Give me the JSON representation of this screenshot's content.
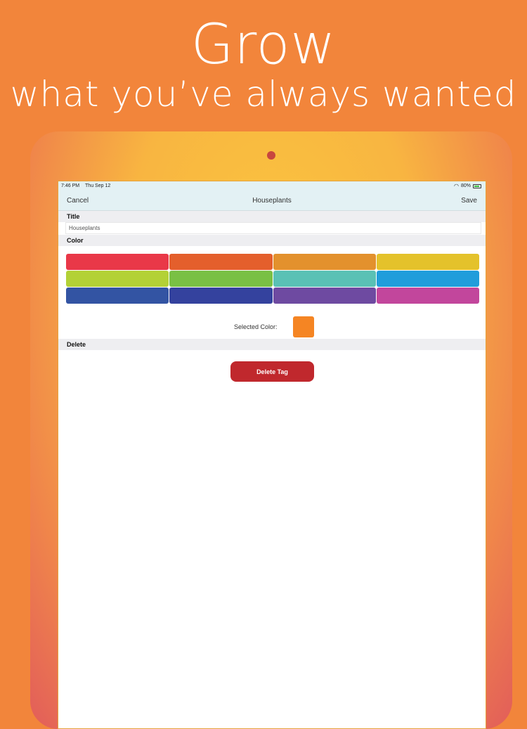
{
  "promo": {
    "headline": "Grow",
    "subheadline": "what you’ve always wanted"
  },
  "status_bar": {
    "time": "7:46 PM",
    "date": "Thu Sep 12",
    "battery": "80%"
  },
  "nav": {
    "cancel_label": "Cancel",
    "title": "Houseplants",
    "save_label": "Save"
  },
  "sections": {
    "title_header": "Title",
    "color_header": "Color",
    "delete_header": "Delete"
  },
  "form": {
    "title_value": "Houseplants"
  },
  "colors": {
    "swatches": [
      "#e93848",
      "#e45f2c",
      "#e3912d",
      "#e4c22b",
      "#b3d136",
      "#79c044",
      "#5ac1b5",
      "#209ddb",
      "#3354a3",
      "#34429e",
      "#6e4aa1",
      "#c2469c"
    ],
    "selected_label": "Selected Color:",
    "selected_color": "#f58523"
  },
  "delete": {
    "button_label": "Delete Tag"
  }
}
